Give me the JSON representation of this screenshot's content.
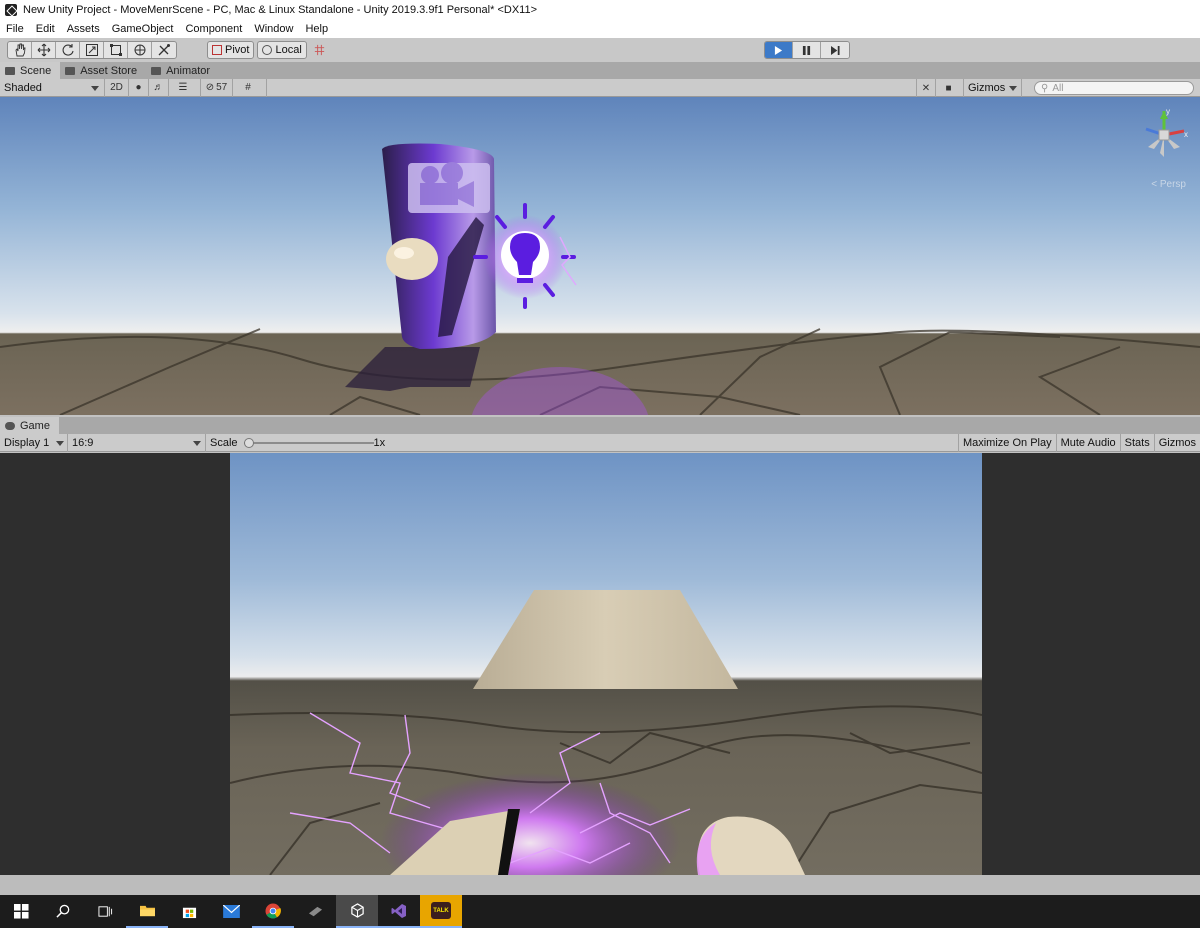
{
  "window": {
    "title": "New Unity Project - MoveMenrScene - PC, Mac & Linux Standalone - Unity 2019.3.9f1 Personal* <DX11>"
  },
  "menu": [
    "File",
    "Edit",
    "Assets",
    "GameObject",
    "Component",
    "Window",
    "Help"
  ],
  "toolbar": {
    "tools": [
      "hand-tool",
      "move-tool",
      "rotate-tool",
      "scale-tool",
      "rect-tool",
      "transform-tool",
      "custom-tool"
    ],
    "pivot_label": "Pivot",
    "local_label": "Local",
    "play_active": true
  },
  "scene_tabs": [
    "Scene",
    "Asset Store",
    "Animator"
  ],
  "scene_controls": {
    "draw_mode": "Shaded",
    "mode_2d": "2D",
    "hidden_count": "57",
    "gizmos_label": "Gizmos",
    "search_placeholder": "All",
    "persp_label": "< Persp"
  },
  "game_tab": "Game",
  "game_controls": {
    "display": "Display 1",
    "aspect": "16:9",
    "scale_label": "Scale",
    "scale_value": "1x",
    "maximize_on_play": "Maximize On Play",
    "mute_audio": "Mute Audio",
    "stats": "Stats",
    "gizmos": "Gizmos"
  },
  "colors": {
    "play_active": "#3d7ac8",
    "editor_bg": "#c2c2c2",
    "taskbar_bg": "#1c1c1c",
    "purple_glow": "#b04cff"
  },
  "taskbar": {
    "items": [
      "start-icon",
      "search-icon",
      "task-view-icon",
      "file-explorer-icon",
      "store-icon",
      "mail-icon",
      "chrome-icon",
      "app-icon",
      "unity-icon",
      "visual-studio-icon",
      "kakaotalk-icon"
    ],
    "kakao_label": "TALK"
  }
}
